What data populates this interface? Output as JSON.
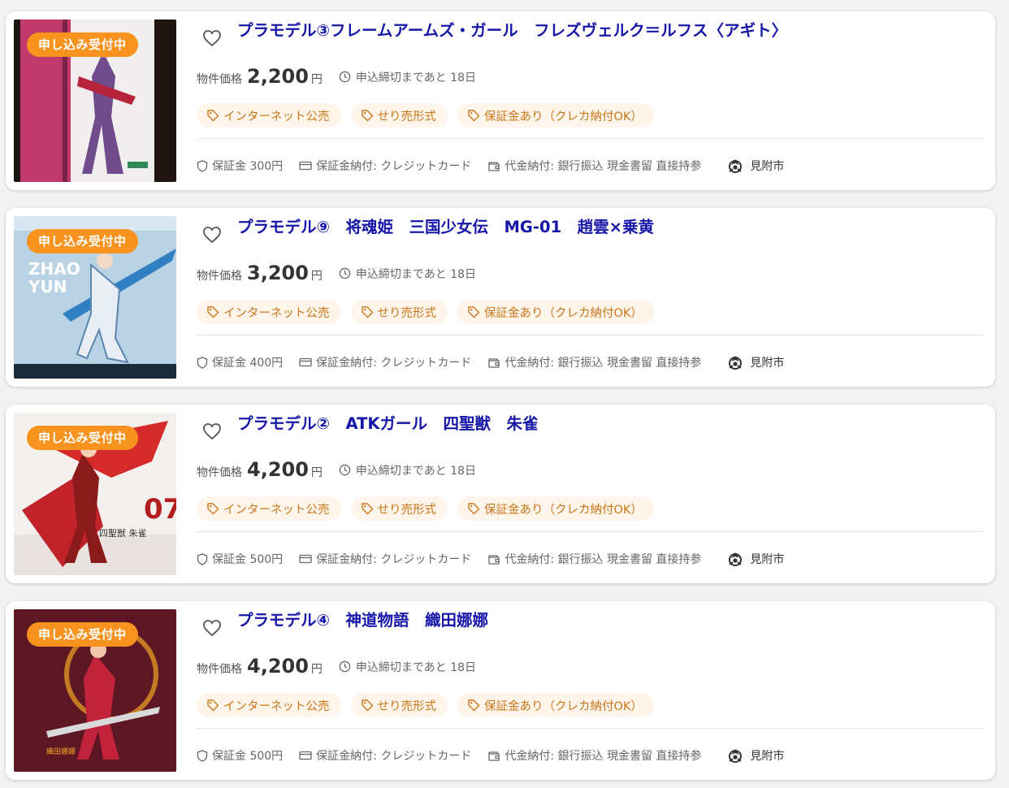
{
  "colors": {
    "badge": "#f7931e",
    "title": "#1616a8",
    "tag_bg": "#fff5ea",
    "tag_text": "#c9771a"
  },
  "icons": {
    "heart": "heart-outline-icon",
    "clock": "clock-icon",
    "tag": "tag-icon",
    "shield": "shield-icon",
    "card": "credit-card-icon",
    "wallet": "wallet-icon",
    "city": "municipality-emblem-icon"
  },
  "listings": [
    {
      "badge": "申し込み受付中",
      "title": "プラモデル③フレームアームズ・ガール　フレズヴェルク＝ルフス〈アギト〉",
      "price_label": "物件価格",
      "price": "2,200",
      "price_unit": "円",
      "deadline": "申込締切まであと 18日",
      "tags": [
        "インターネット公売",
        "せり売形式",
        "保証金あり（クレカ納付OK）"
      ],
      "deposit": "保証金 300円",
      "deposit_payment": "保証金納付: クレジットカード",
      "payment": "代金納付: 銀行振込 現金書留 直接持参",
      "city": "見附市"
    },
    {
      "badge": "申し込み受付中",
      "title": "プラモデル⑨　将魂姫　三国少女伝　MG-01　趙雲×乗黄",
      "price_label": "物件価格",
      "price": "3,200",
      "price_unit": "円",
      "deadline": "申込締切まであと 18日",
      "tags": [
        "インターネット公売",
        "せり売形式",
        "保証金あり（クレカ納付OK）"
      ],
      "deposit": "保証金 400円",
      "deposit_payment": "保証金納付: クレジットカード",
      "payment": "代金納付: 銀行振込 現金書留 直接持参",
      "city": "見附市"
    },
    {
      "badge": "申し込み受付中",
      "title": "プラモデル②　ATKガール　四聖獣　朱雀",
      "price_label": "物件価格",
      "price": "4,200",
      "price_unit": "円",
      "deadline": "申込締切まであと 18日",
      "tags": [
        "インターネット公売",
        "せり売形式",
        "保証金あり（クレカ納付OK）"
      ],
      "deposit": "保証金 500円",
      "deposit_payment": "保証金納付: クレジットカード",
      "payment": "代金納付: 銀行振込 現金書留 直接持参",
      "city": "見附市"
    },
    {
      "badge": "申し込み受付中",
      "title": "プラモデル④　神道物語　織田娜娜",
      "price_label": "物件価格",
      "price": "4,200",
      "price_unit": "円",
      "deadline": "申込締切まであと 18日",
      "tags": [
        "インターネット公売",
        "せり売形式",
        "保証金あり（クレカ納付OK）"
      ],
      "deposit": "保証金 500円",
      "deposit_payment": "保証金納付: クレジットカード",
      "payment": "代金納付: 銀行振込 現金書留 直接持参",
      "city": "見附市"
    }
  ]
}
